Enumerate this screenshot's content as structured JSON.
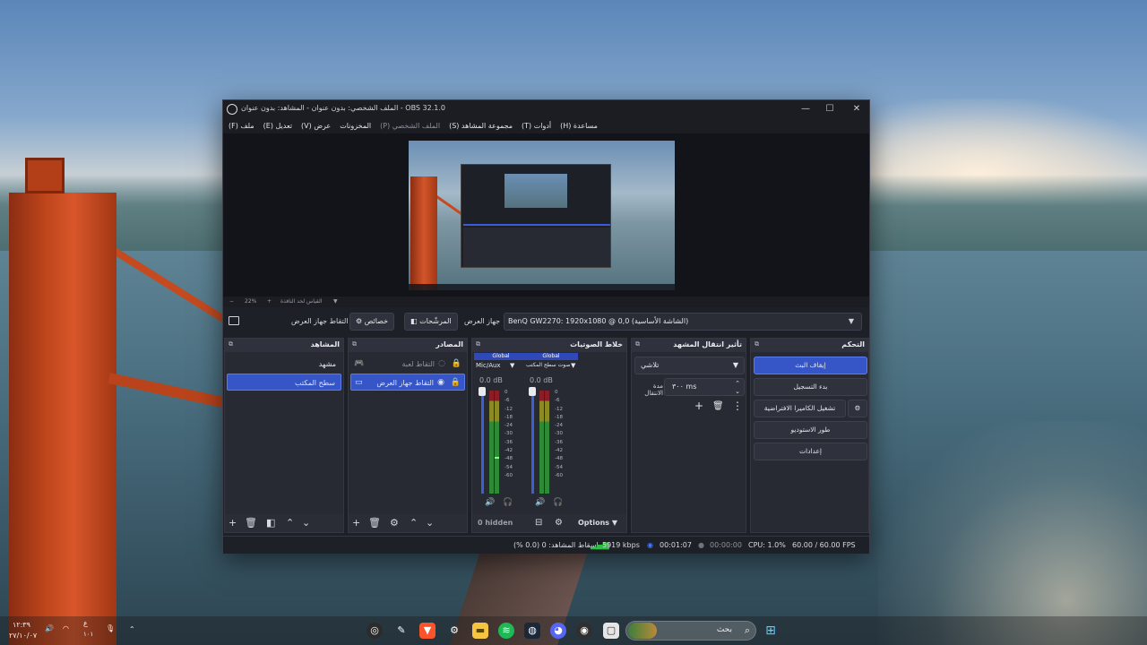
{
  "window": {
    "title": "OBS 32.1.0 - الملف الشخصي: بدون عنوان - المشاهد: بدون عنوان",
    "minimize": "—",
    "maximize": "☐",
    "close": "✕"
  },
  "menu": [
    {
      "label": "ملف (F)"
    },
    {
      "label": "تعديل (E)"
    },
    {
      "label": "عرض (V)"
    },
    {
      "label": "المخزونات"
    },
    {
      "label": "الملف الشخصي (P)"
    },
    {
      "label": "مجموعة المشاهد (S)"
    },
    {
      "label": "أدوات (T)"
    },
    {
      "label": "مساعدة (H)"
    }
  ],
  "zoombar": {
    "minus": "−",
    "zoom": "22%",
    "plus": "+",
    "fit": "القياس لحد النافذة",
    "arrow": "▼"
  },
  "source_toolbar": {
    "selected_source": "التقاط جهاز العرض",
    "properties": "خصائص",
    "filters": "المرشّحات",
    "display_label": "جهاز العرض",
    "display_value": "BenQ GW2270: 1920x1080 @ 0,0 (الشاشة الأساسية)"
  },
  "scenes": {
    "title": "المشاهد",
    "items": [
      "مشهد",
      "سطح المكتب"
    ]
  },
  "sources": {
    "title": "المصادر",
    "items": [
      "التقاط لعبة",
      "التقاط جهاز العرض"
    ]
  },
  "mixer": {
    "title": "خلاط الصوتيات",
    "channels": [
      {
        "tag": "Global",
        "name": "Mic/Aux",
        "db": "0.0 dB"
      },
      {
        "tag": "Global",
        "name": "صوت سطح المكتب",
        "db": "0.0 dB"
      }
    ],
    "ticks": [
      "0",
      "-6",
      "-12",
      "-18",
      "-24",
      "-30",
      "-36",
      "-42",
      "-48",
      "-54",
      "-60"
    ],
    "hidden": "0 hidden",
    "options": "Options"
  },
  "transitions": {
    "title": "تأثير انتقال المشهد",
    "type": "تلاشي",
    "duration_label": "مدة الانتقال",
    "duration_value": "٣٠٠ ms"
  },
  "controls": {
    "title": "التحكم",
    "stop_stream": "إيقاف البث",
    "start_record": "بدء التسجيل",
    "virtual_cam": "تشغيل الكاميرا الافتراضية",
    "studio_mode": "طور الاستوديو",
    "settings": "إعدادات"
  },
  "status": {
    "dropped": "إسقاط المشاهد: 0 (0.0 %)",
    "bitrate": "5919 kbps",
    "stream_time": "00:01:07",
    "record_time": "00:00:00",
    "cpu": "CPU: 1.0%",
    "fps": "60.00 / 60.00 FPS"
  },
  "taskbar": {
    "search_label": "بحث",
    "time": "١٢:٣٩",
    "date": "٢٧/١٠/٠٧",
    "lang_top": "ع",
    "lang_bottom": "١٠١"
  },
  "colors": {
    "accent": "#3656c8",
    "window_bg": "#1e2027",
    "dock_bg": "#272a33",
    "bitrate_green": "#2fbf45"
  }
}
